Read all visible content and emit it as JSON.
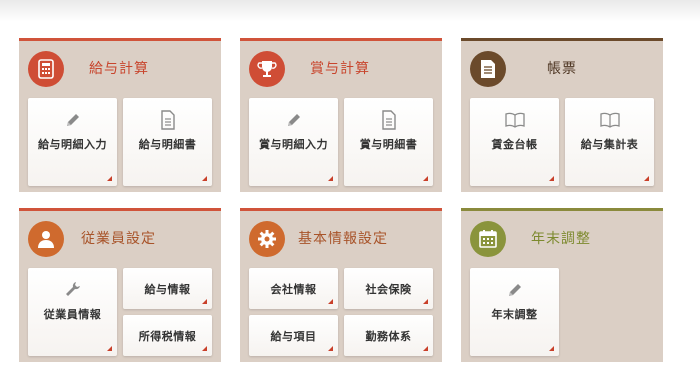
{
  "panels": {
    "kyuyo": {
      "title": "給与計算",
      "icon": "calculator-icon",
      "buttons": [
        "給与明細入力",
        "給与明細書"
      ]
    },
    "shoyo": {
      "title": "賞与計算",
      "icon": "trophy-icon",
      "buttons": [
        "賞与明細入力",
        "賞与明細書"
      ]
    },
    "chohyo": {
      "title": "帳票",
      "icon": "document-icon",
      "buttons": [
        "賃金台帳",
        "給与集計表"
      ]
    },
    "jugyoin": {
      "title": "従業員設定",
      "icon": "person-icon",
      "buttons": [
        "従業員情報",
        "給与情報",
        "所得税情報"
      ]
    },
    "kihon": {
      "title": "基本情報設定",
      "icon": "gear-icon",
      "buttons": [
        "会社情報",
        "社会保険",
        "給与項目",
        "勤務体系"
      ]
    },
    "nenmatsu": {
      "title": "年末調整",
      "icon": "calendar-icon",
      "buttons": [
        "年末調整"
      ]
    }
  },
  "colors": {
    "accent_red": "#c9402a",
    "panel_bg": "#dbcfc5",
    "brown": "#6b4a2b",
    "olive": "#8a943c"
  }
}
